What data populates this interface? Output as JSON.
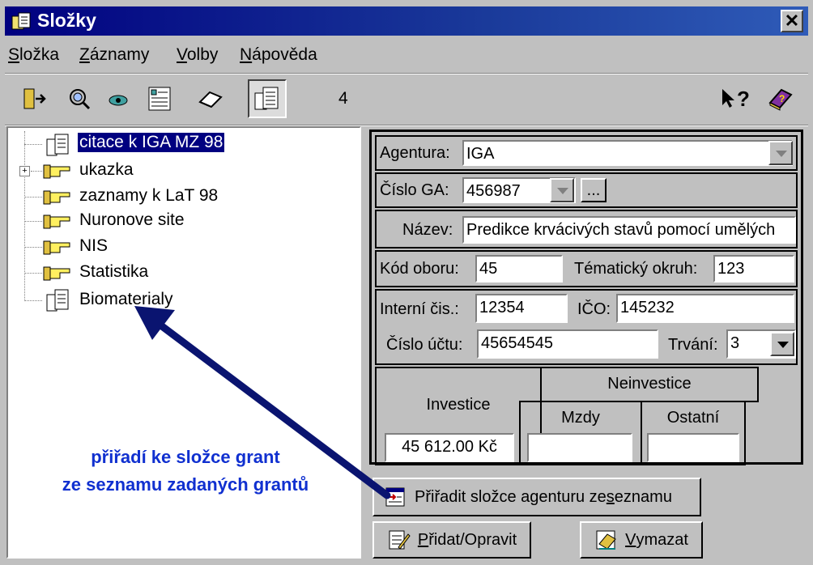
{
  "window": {
    "title": "Složky",
    "close_glyph": "✕"
  },
  "menu": [
    {
      "label": "Složka",
      "accel": "S"
    },
    {
      "label": "Záznamy",
      "accel": "Z"
    },
    {
      "label": "Volby",
      "accel": "V"
    },
    {
      "label": "Nápověda",
      "accel": "N"
    }
  ],
  "toolbar": {
    "count": "4",
    "help_glyph": "?"
  },
  "tree": {
    "items": [
      {
        "label": "citace k IGA MZ 98",
        "icon": "folder-doc-icon",
        "selected": true
      },
      {
        "label": "ukazka",
        "icon": "hand-pointer-icon",
        "expandable": true
      },
      {
        "label": "zaznamy k LaT 98",
        "icon": "hand-pointer-icon"
      },
      {
        "label": "Nuronove site",
        "icon": "hand-pointer-icon"
      },
      {
        "label": "NIS",
        "icon": "hand-pointer-icon"
      },
      {
        "label": "Statistika",
        "icon": "hand-pointer-icon"
      },
      {
        "label": "Biomaterialy",
        "icon": "folder-doc-icon"
      }
    ],
    "expand_glyph": "+"
  },
  "annotation": {
    "line1": "přiřadí ke složce grant",
    "line2": "ze seznamu zadaných grantů"
  },
  "form": {
    "agentura_label": "Agentura:",
    "agentura_value": "IGA",
    "cislo_ga_label": "Číslo GA:",
    "cislo_ga_value": "456987",
    "ellipsis": "...",
    "nazev_label": "Název:",
    "nazev_value": "Predikce krvácivých stavů pomocí umělých",
    "kod_oboru_label": "Kód oboru:",
    "kod_oboru_value": "45",
    "tematicky_okruh_label": "Tématický okruh:",
    "tematicky_okruh_value": "123",
    "interni_cis_label": "Interní čis.:",
    "interni_cis_value": "12354",
    "ico_label": "IČO:",
    "ico_value": "145232",
    "cislo_uctu_label": "Číslo účtu:",
    "cislo_uctu_value": "45654545",
    "trvani_label": "Trvání:",
    "trvani_value": "3",
    "investice_label": "Investice",
    "investice_value": "45 612.00 Kč",
    "neinvestice_label": "Neinvestice",
    "mzdy_label": "Mzdy",
    "mzdy_value": "",
    "ostatni_label": "Ostatní",
    "ostatni_value": ""
  },
  "buttons": {
    "assign": {
      "pre": "Přiřadit složce agenturu ze ",
      "accel": "s",
      "post": "eznamu"
    },
    "add": {
      "pre": "",
      "accel": "P",
      "post": "řidat/Opravit"
    },
    "delete": {
      "pre": "",
      "accel": "V",
      "post": "ymazat"
    }
  },
  "colors": {
    "title_bar": "#000080",
    "annotation_text": "#1030d0",
    "arrow": "#0a1470",
    "selection": "#000080"
  }
}
